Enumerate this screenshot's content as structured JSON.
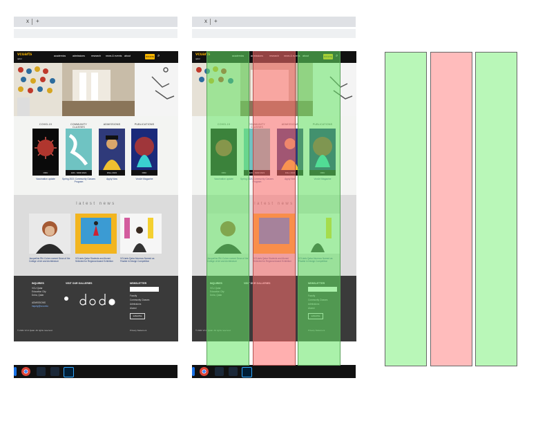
{
  "browser": {
    "close_glyph": "x",
    "new_tab_glyph": "+"
  },
  "site": {
    "logo": "vcuarts",
    "logo_sub": "qatar",
    "nav": [
      "academics",
      "admissions",
      "research",
      "news & events",
      "about"
    ],
    "donate": "DONATE",
    "categories": [
      {
        "title": "COVID-19",
        "badge": "ODU",
        "caption": "Vaccination update"
      },
      {
        "title": "COMMUNITY CLASSES",
        "badge": "JAN - MAR 2021",
        "caption": "Spring 2021 Community Classes Program"
      },
      {
        "title": "ADMISSIONS",
        "badge": "FALL 2021",
        "caption": "Apply Now"
      },
      {
        "title": "PUBLICATIONS",
        "badge": "ODU",
        "caption": "VoxArt Magazine"
      }
    ],
    "news_title": "latest news",
    "news": [
      {
        "caption": "Jacqueline Rhi-Cohen named Dean of the College of Art and Architecture"
      },
      {
        "caption": "VCUarts Qatar Students and Alumni Selected for Regional Award Exhibition"
      },
      {
        "caption": "VCUarts Qatar Alumnus Named as Finalist in Design Competition"
      }
    ],
    "footer": {
      "col1_head": "INQUIRIES",
      "col1_lines": [
        "VCU Qatar",
        "Education City",
        "Doha, Qatar"
      ],
      "col1_extra": [
        "ADMISSIONS",
        "inquiry@vcu.edu"
      ],
      "col2_head": "VISIT OUR GALLERIES",
      "col3_head": "NEWSLETTER",
      "checks": [
        "Faculty",
        "Community Classes",
        "Admissions",
        "Alumni"
      ],
      "subscribe": "subscribe",
      "copyright": "© 2021 VCU Qatar. All rights reserved.",
      "privacy": "Privacy Statement"
    }
  },
  "colors": {
    "overlay_green": "#9cf59a",
    "overlay_red": "#ff8e8e",
    "accent": "#f6b400"
  }
}
